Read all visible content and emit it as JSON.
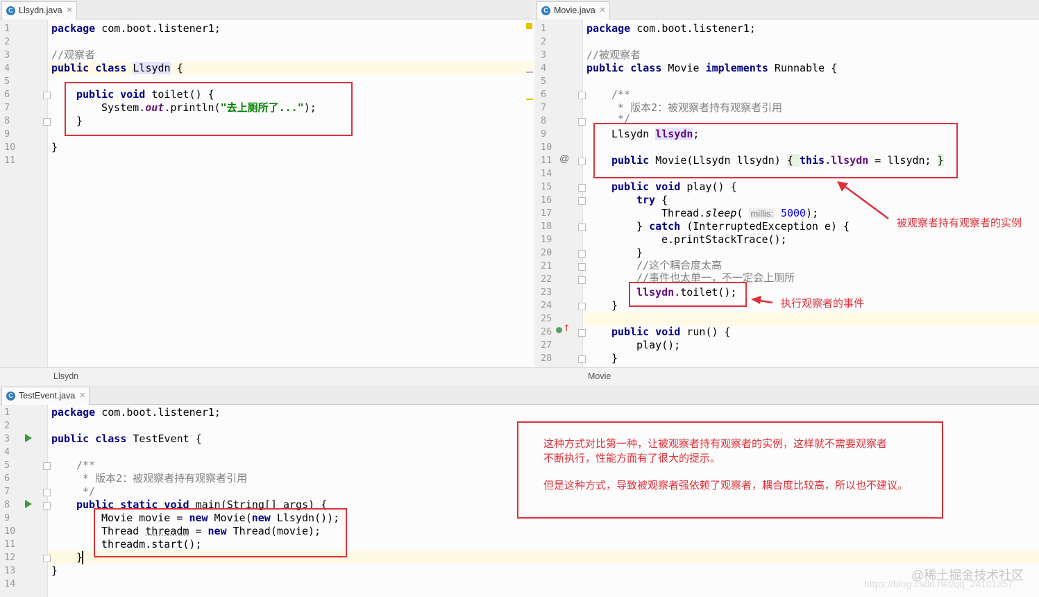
{
  "tabs": {
    "left": "Llsydn.java",
    "right": "Movie.java",
    "bottom": "TestEvent.java"
  },
  "status": {
    "left": "Llsydn",
    "right": "Movie"
  },
  "left_lines": [
    "1",
    "2",
    "3",
    "4",
    "5",
    "6",
    "7",
    "8",
    "9",
    "10",
    "11"
  ],
  "right_lines": [
    "1",
    "2",
    "3",
    "4",
    "5",
    "6",
    "7",
    "8",
    "9",
    "10",
    "11",
    "14",
    "15",
    "16",
    "17",
    "18",
    "19",
    "20",
    "21",
    "22",
    "23",
    "24",
    "25",
    "26",
    "27",
    "28"
  ],
  "bottom_lines": [
    "1",
    "2",
    "3",
    "4",
    "5",
    "6",
    "7",
    "8",
    "9",
    "10",
    "11",
    "12",
    "13",
    "14"
  ],
  "code": {
    "package": "package",
    "pkg_name": " com.boot.listener1;",
    "public_class": "public class",
    "left_comment": "//观察者",
    "llsydn_class": "Llsydn",
    "brace_open": " {",
    "public_void": "public void",
    "toilet_sig": " toilet() {",
    "sysout_pre": "System.",
    "out": "out",
    "println": ".println(",
    "toilet_str": "\"去上厕所了...\"",
    "println_end": ");",
    "close_brace": "}",
    "right_comment": "//被观察者",
    "movie_class": " Movie ",
    "implements": "implements",
    "runnable": " Runnable {",
    "javadoc_open": "/**",
    "javadoc_line": " * 版本2：被观察者持有观察者引用",
    "javadoc_close": " */",
    "field_type": "Llsydn ",
    "field_name": "llsydn",
    "semicolon": ";",
    "public": "public",
    "ctor_sig": " Movie(Llsydn llsydn) ",
    "ctor_open": "{ ",
    "this": "this",
    "dot_llsydn": ".llsydn",
    "ctor_assign": " = llsydn; ",
    "ctor_close": "}",
    "play_sig": " play() {",
    "try": "try",
    "thread_sleep_pre": "Thread.",
    "sleep": "sleep",
    "paren_open": "( ",
    "millis": "millis:",
    "sleep_val": "5000",
    "sleep_end": ");",
    "catch_pre": "} ",
    "catch": "catch",
    "catch_sig": " (InterruptedException e) {",
    "print_stack": "e.printStackTrace();",
    "comment_coupling": "//这个耦合度太高",
    "comment_event": "//事件也太单一，不一定会上厕所",
    "call_llsydn": "llsydn",
    "call_toilet": ".toilet();",
    "run_sig": " run() {",
    "play_call": "play();",
    "test_class": " TestEvent {",
    "public_static_void": "public static void",
    "main_sig": " main(String[] args) {",
    "movie_decl_pre": "Movie movie = ",
    "new": "new",
    "movie_decl_mid": " Movie(",
    "movie_decl_end": " Llsydn());",
    "thread_decl_pre": "Thread ",
    "threadm": "threadm",
    "thread_decl_mid": " = ",
    "thread_decl_end": " Thread(movie);",
    "threadm_start": "threadm.start();"
  },
  "notes": {
    "instance": "被观察者持有观察者的实例",
    "event": "执行观察者的事件",
    "summary_1": "这种方式对比第一种，让被观察者持有观察者的实例，这样就不需要观察者",
    "summary_2": "不断执行，性能方面有了很大的提示。",
    "summary_3": "但是这种方式，导致被观察者强依赖了观察者，耦合度比较高，所以也不建议。"
  },
  "watermark": {
    "brand": "@稀土掘金技术社区",
    "url": "https://blog.csdn.net/qq_24101357"
  },
  "colors": {
    "annotation": "#e0303a",
    "keyword": "#000080",
    "string": "#008000",
    "field": "#660e7a"
  }
}
